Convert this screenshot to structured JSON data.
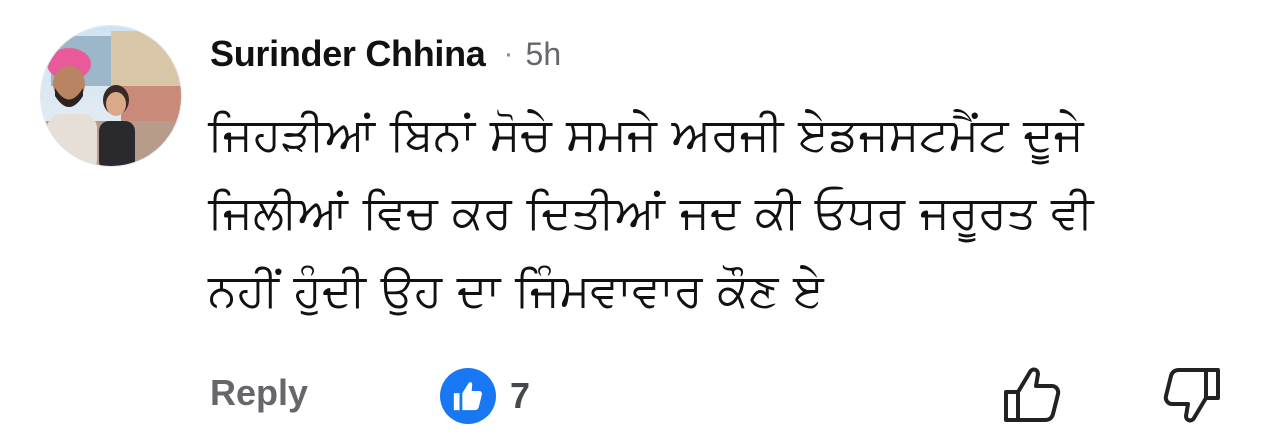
{
  "comment": {
    "author": "Surinder Chhina",
    "separator": "·",
    "time": "5h",
    "body_lines": [
      "ਜਿਹੜੀਆਂ ਬਿਨਾਂ ਸੋਚੇ ਸਮਜੇ ਅਰਜੀ ਏਡਜਸਟਮੈਂਟ ਦੂਜੇ",
      "ਜਿਲੀਆਂ ਵਿਚ ਕਰ ਦਿਤੀਆਂ ਜਦ ਕੀ ਓਧਰ ਜਰੂਰਤ ਵੀ",
      "ਨਹੀਂ ਹੁੰਦੀ ਉਹ ਦਾ ਜਿੰਮਵਾਵਾਰ ਕੌਣ ਏ"
    ],
    "avatar_icon": "profile-photo-avatar"
  },
  "actions": {
    "reply_label": "Reply",
    "reaction_icon": "thumbs-up-reaction-icon",
    "reaction_count": "7",
    "like_icon": "thumbs-up-outline-icon",
    "dislike_icon": "thumbs-down-outline-icon"
  },
  "colors": {
    "reaction_blue": "#1877f2",
    "secondary_text": "#65676b",
    "primary_text": "#111111"
  }
}
